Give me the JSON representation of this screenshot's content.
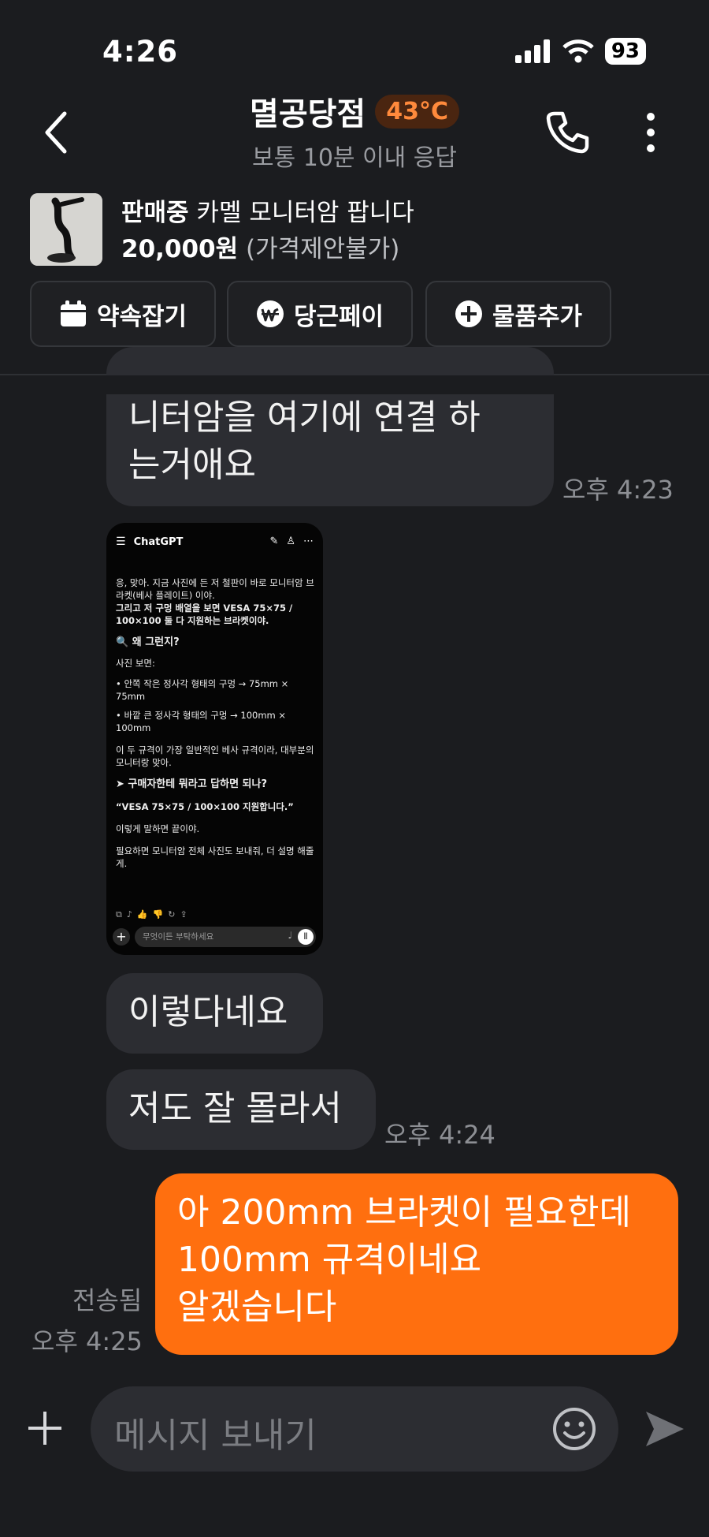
{
  "status": {
    "time": "4:26",
    "battery": "93"
  },
  "header": {
    "title": "멸공당점",
    "temperature": "43°C",
    "response_time": "보통 10분 이내 응답"
  },
  "product": {
    "status": "판매중",
    "title": "카멜 모니터암 팝니다",
    "price": "20,000원",
    "price_note": "(가격제안불가)"
  },
  "actions": {
    "schedule": "약속잡기",
    "pay": "당근페이",
    "add_item": "물품추가"
  },
  "messages": {
    "m1_line1": "니터암을 여기에 연결 하",
    "m1_line2": "는거애요",
    "m1_time": "오후 4:23",
    "m2": "이렇다네요",
    "m3": "저도 잘 몰라서",
    "m3_time": "오후 4:24",
    "m4_line1": "아 200mm 브라켓이 필요한데",
    "m4_line2": "100mm 규격이네요",
    "m4_line3": "알겠습니다",
    "m4_status": "전송됨",
    "m4_time": "오후 4:25"
  },
  "screenshot": {
    "app": "ChatGPT",
    "p1": "응, 맞아. 지금 사진에 든 저 철판이 바로 모니터암 브라켓(베사 플레이트) 이야.",
    "p2": "그리고 저 구멍 배열을 보면 VESA 75×75 / 100×100 둘 다 지원하는 브라켓이야.",
    "h1": "🔍 왜 그런지?",
    "p3": "사진 보면:",
    "b1": "• 안쪽 작은 정사각 형태의 구멍 → 75mm × 75mm",
    "b2": "• 바깥 큰 정사각 형태의 구멍 → 100mm × 100mm",
    "p4": "이 두 규격이 가장 일반적인 베사 규격이라, 대부분의 모니터랑 맞아.",
    "h2": "➤ 구매자한테 뭐라고 답하면 되나?",
    "quote": "“VESA 75×75 / 100×100 지원합니다.”",
    "p5": "이렇게 말하면 끝이야.",
    "p6": "필요하면 모니터암 전체 사진도 보내줘, 더 설명 해줄게.",
    "input_placeholder": "무엇이든 부탁하세요"
  },
  "composer": {
    "placeholder": "메시지 보내기"
  }
}
